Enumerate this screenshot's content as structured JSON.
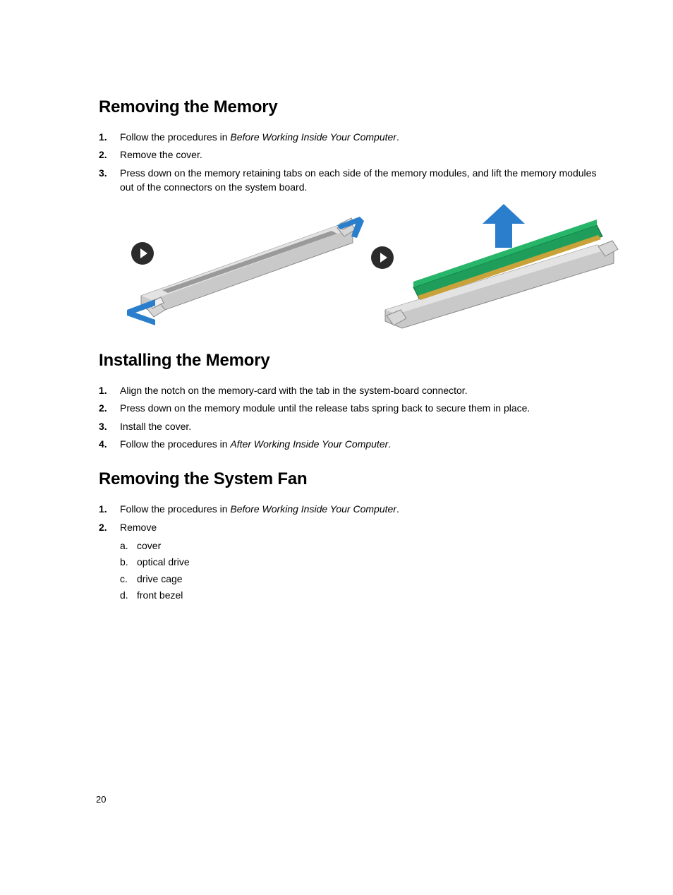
{
  "page_number": "20",
  "sections": [
    {
      "heading": "Removing the Memory",
      "steps": [
        {
          "pre": "Follow the procedures in ",
          "em": "Before Working Inside Your Computer",
          "post": "."
        },
        {
          "text": "Remove the cover."
        },
        {
          "text": "Press down on the memory retaining tabs on each side of the memory modules, and lift the memory modules out of the connectors on the system board."
        }
      ]
    },
    {
      "heading": "Installing the Memory",
      "steps": [
        {
          "text": "Align the notch on the memory-card with the tab in the system-board connector."
        },
        {
          "text": "Press down on the memory module until the release tabs spring back to secure them in place."
        },
        {
          "text": "Install the cover."
        },
        {
          "pre": "Follow the procedures in ",
          "em": "After Working Inside Your Computer",
          "post": "."
        }
      ]
    },
    {
      "heading": "Removing the System Fan",
      "steps": [
        {
          "pre": "Follow the procedures in ",
          "em": "Before Working Inside Your Computer",
          "post": "."
        },
        {
          "text": "Remove",
          "sub": [
            "cover",
            "optical drive",
            "drive cage",
            "front bezel"
          ]
        }
      ]
    }
  ],
  "figure": {
    "left_alt": "Memory slot with retention clips opening outward (blue arrows)",
    "right_alt": "Memory module lifting up out of slot (blue arrow up)"
  }
}
